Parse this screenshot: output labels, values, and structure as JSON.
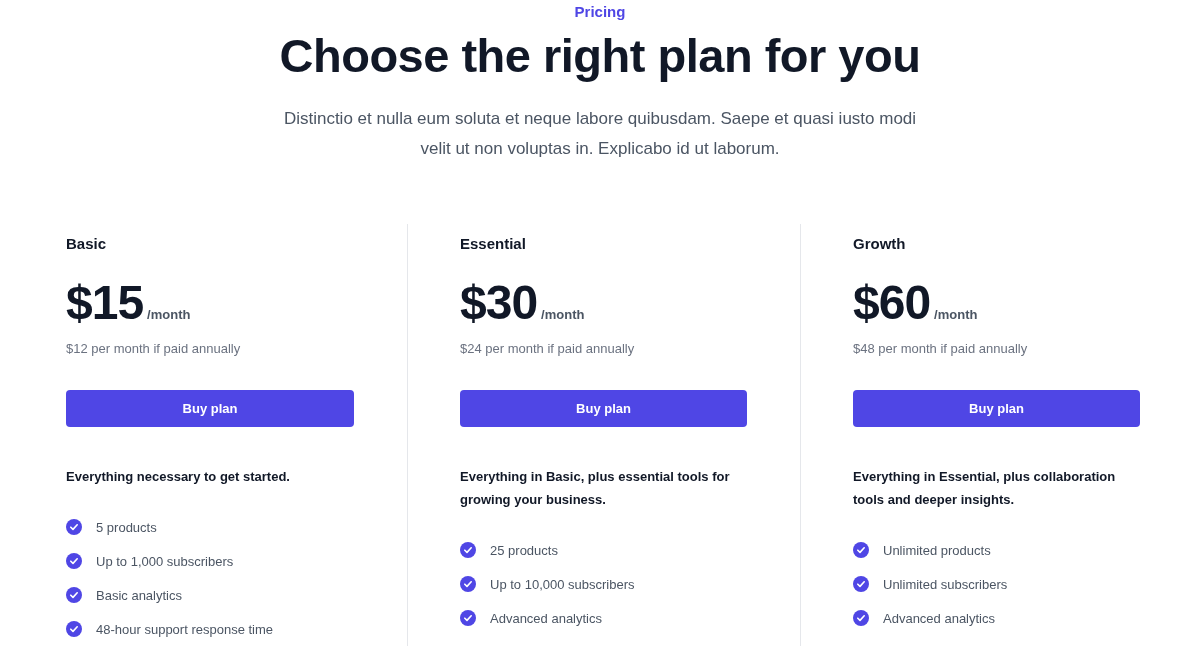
{
  "eyebrow": "Pricing",
  "heading": "Choose the right plan for you",
  "description": "Distinctio et nulla eum soluta et neque labore quibusdam. Saepe et quasi iusto modi velit ut non voluptas in. Explicabo id ut laborum.",
  "plans": [
    {
      "name": "Basic",
      "price": "$15",
      "period": "/month",
      "annual": "$12 per month if paid annually",
      "button": "Buy plan",
      "tagline": "Everything necessary to get started.",
      "features": [
        "5 products",
        "Up to 1,000 subscribers",
        "Basic analytics",
        "48-hour support response time"
      ]
    },
    {
      "name": "Essential",
      "price": "$30",
      "period": "/month",
      "annual": "$24 per month if paid annually",
      "button": "Buy plan",
      "tagline": "Everything in Basic, plus essential tools for growing your business.",
      "features": [
        "25 products",
        "Up to 10,000 subscribers",
        "Advanced analytics"
      ]
    },
    {
      "name": "Growth",
      "price": "$60",
      "period": "/month",
      "annual": "$48 per month if paid annually",
      "button": "Buy plan",
      "tagline": "Everything in Essential, plus collaboration tools and deeper insights.",
      "features": [
        "Unlimited products",
        "Unlimited subscribers",
        "Advanced analytics"
      ]
    }
  ]
}
